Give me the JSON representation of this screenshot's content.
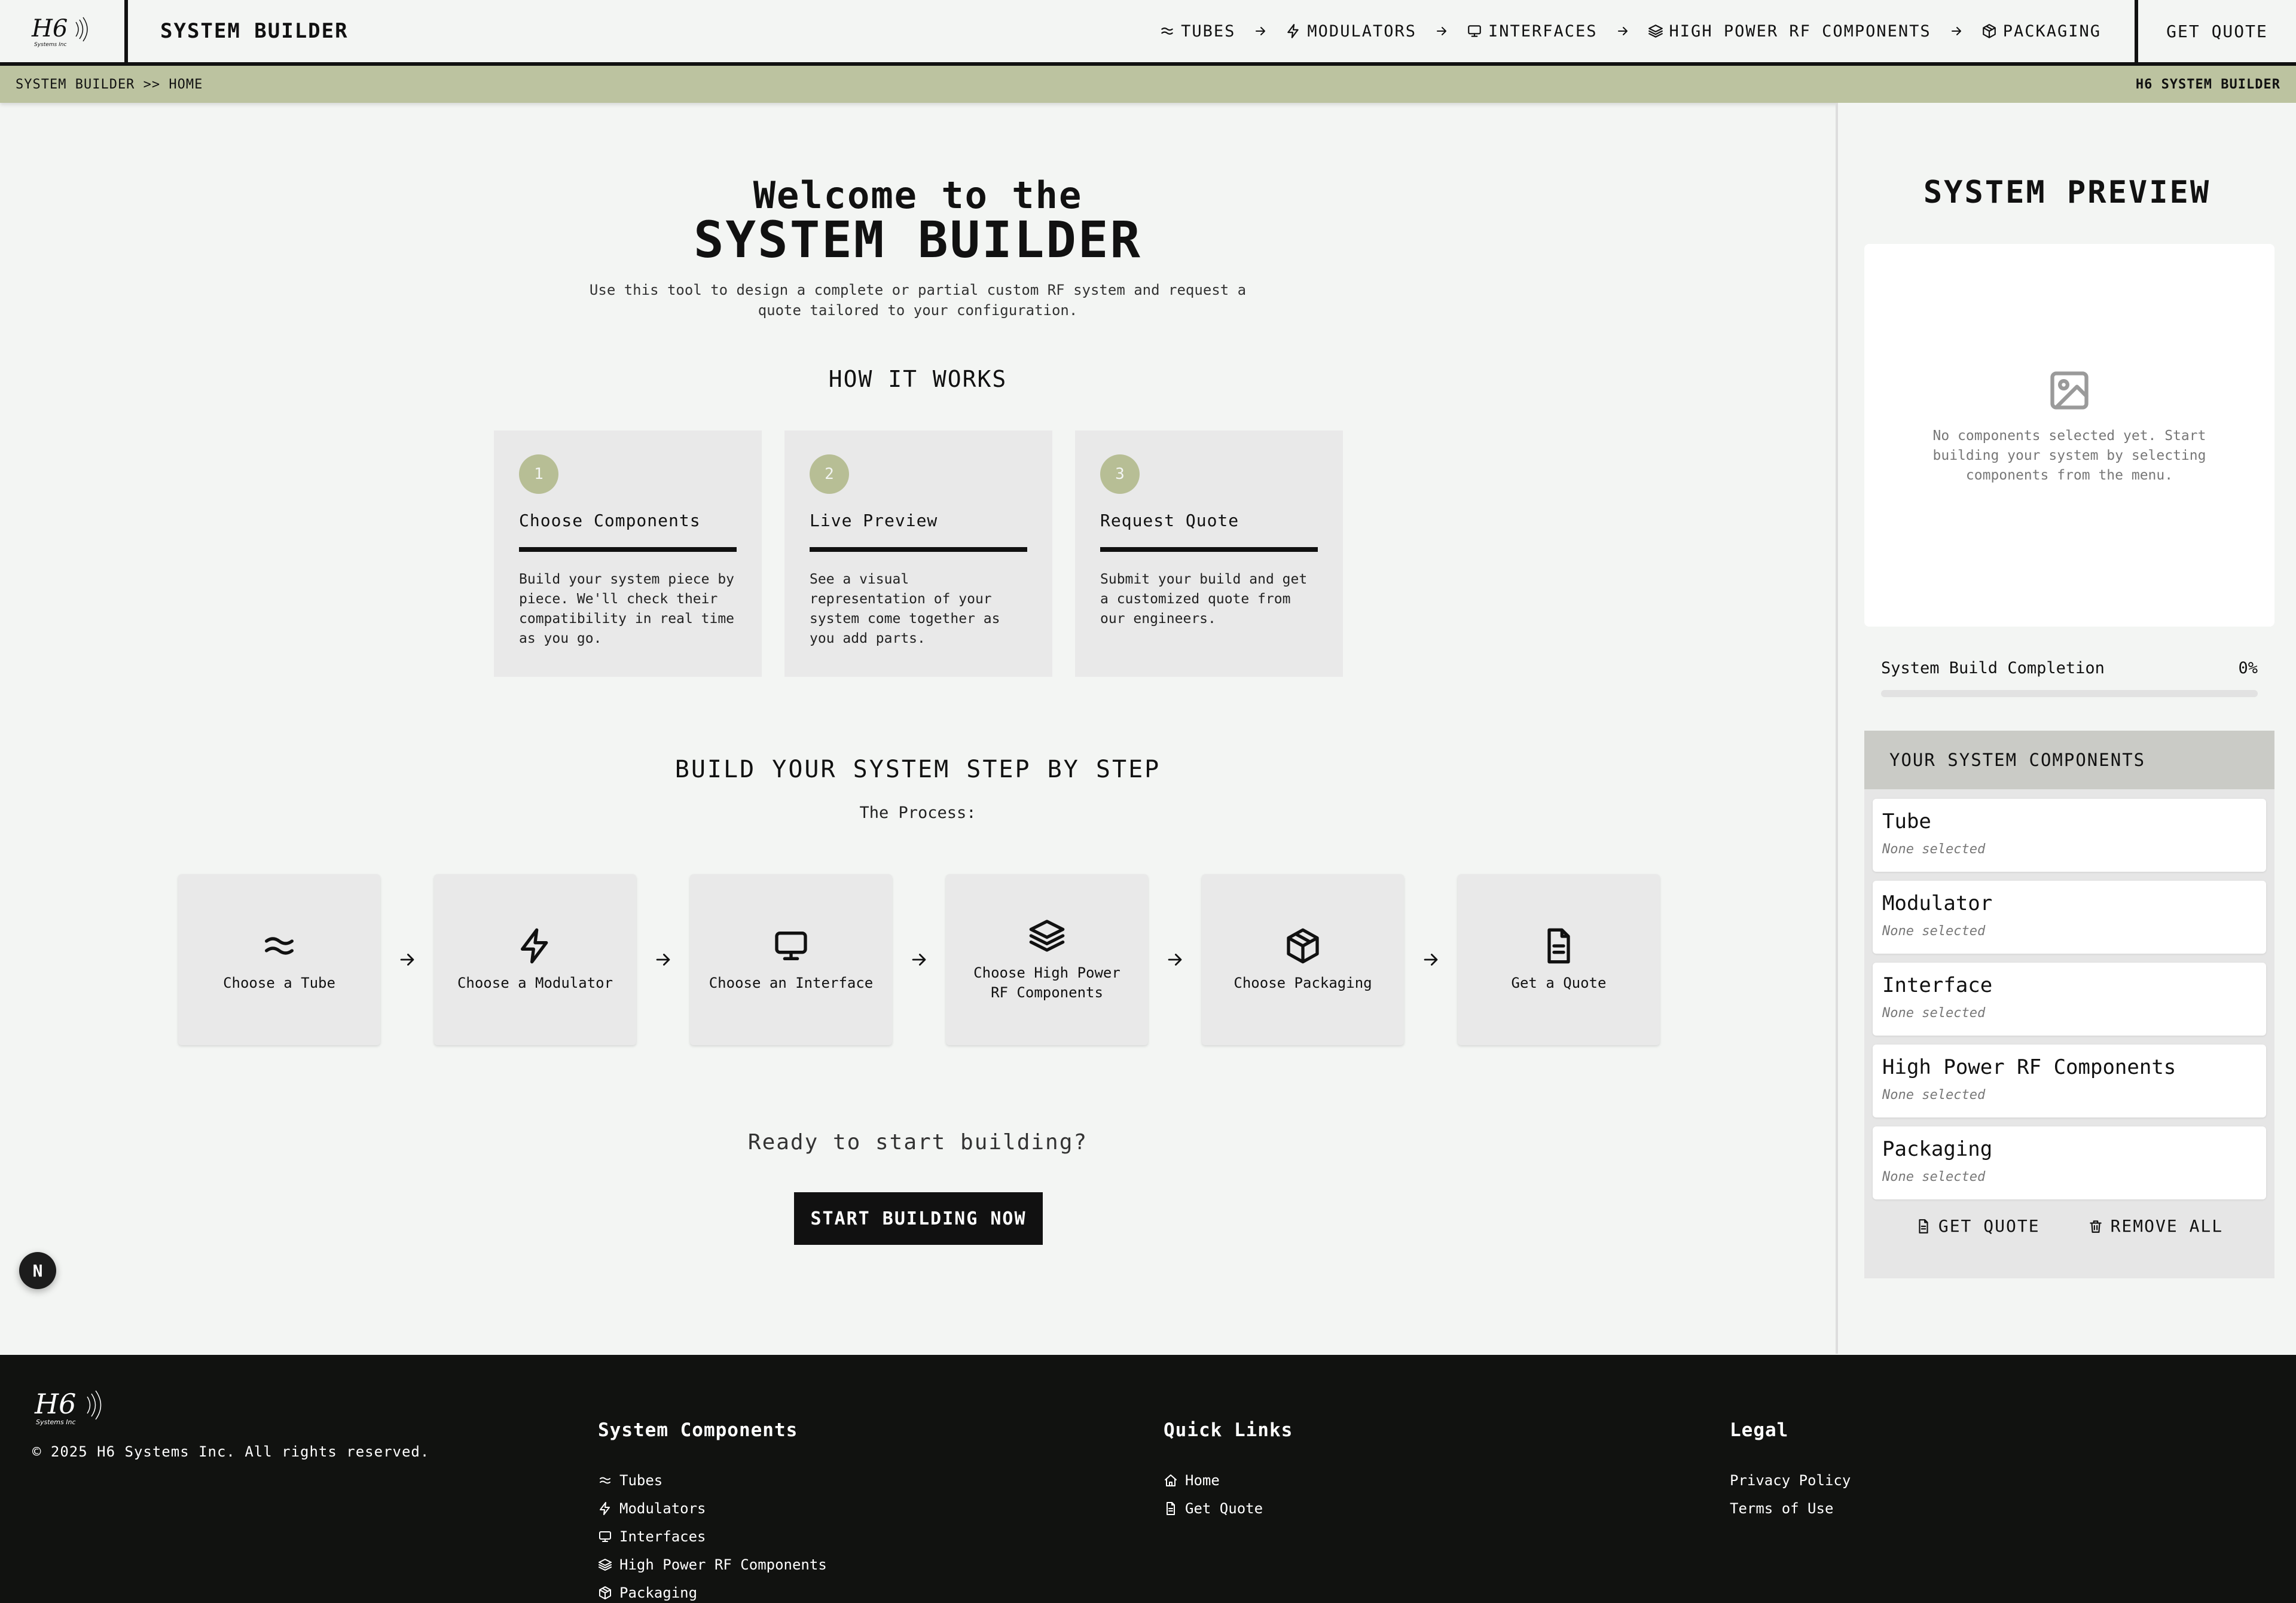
{
  "header": {
    "logo_text": "H6",
    "logo_sub": "Systems Inc",
    "title": "SYSTEM BUILDER",
    "nav": [
      {
        "label": "TUBES",
        "icon": "wave-icon"
      },
      {
        "label": "MODULATORS",
        "icon": "zap-icon"
      },
      {
        "label": "INTERFACES",
        "icon": "monitor-icon"
      },
      {
        "label": "HIGH POWER RF COMPONENTS",
        "icon": "layers-icon"
      },
      {
        "label": "PACKAGING",
        "icon": "box-icon"
      }
    ],
    "quote_label": "GET QUOTE"
  },
  "breadcrumb": {
    "path": "SYSTEM BUILDER >> HOME",
    "right": "H6 SYSTEM BUILDER"
  },
  "welcome": {
    "line1": "Welcome to the",
    "line2": "SYSTEM BUILDER",
    "intro": "Use this tool to design a complete or partial custom RF system and request a quote tailored to your configuration."
  },
  "how": {
    "title": "HOW IT WORKS",
    "cards": [
      {
        "num": "1",
        "title": "Choose Components",
        "text": "Build your system piece by piece. We'll check their compatibility in real time as you go."
      },
      {
        "num": "2",
        "title": "Live Preview",
        "text": "See a visual representation of your system come together as you add parts."
      },
      {
        "num": "3",
        "title": "Request Quote",
        "text": "Submit your build and get a customized quote from our engineers."
      }
    ]
  },
  "steps": {
    "title": "BUILD YOUR SYSTEM STEP BY STEP",
    "subtitle": "The Process:",
    "items": [
      {
        "label": "Choose a Tube",
        "icon": "wave-icon"
      },
      {
        "label": "Choose a Modulator",
        "icon": "zap-icon"
      },
      {
        "label": "Choose an Interface",
        "icon": "monitor-icon"
      },
      {
        "label": "Choose High Power RF Components",
        "icon": "layers-icon"
      },
      {
        "label": "Choose Packaging",
        "icon": "box-icon"
      },
      {
        "label": "Get a Quote",
        "icon": "file-icon"
      }
    ]
  },
  "cta": {
    "question": "Ready to start building?",
    "button": "START BUILDING NOW"
  },
  "badge": "N",
  "sidebar": {
    "title": "SYSTEM PREVIEW",
    "empty_text": "No components selected yet. Start building your system by selecting components from the menu.",
    "completion_label": "System Build Completion",
    "completion_value": "0%",
    "completion_fraction": 0,
    "components_title": "YOUR SYSTEM COMPONENTS",
    "components": [
      {
        "name": "Tube",
        "status": "None selected"
      },
      {
        "name": "Modulator",
        "status": "None selected"
      },
      {
        "name": "Interface",
        "status": "None selected"
      },
      {
        "name": "High Power RF Components",
        "status": "None selected"
      },
      {
        "name": "Packaging",
        "status": "None selected"
      }
    ],
    "get_quote": "GET QUOTE",
    "remove_all": "REMOVE ALL"
  },
  "footer": {
    "copyright": "© 2025 H6 Systems Inc. All rights reserved.",
    "col1_title": "System Components",
    "col1_links": [
      {
        "label": "Tubes",
        "icon": "wave-icon"
      },
      {
        "label": "Modulators",
        "icon": "zap-icon"
      },
      {
        "label": "Interfaces",
        "icon": "monitor-icon"
      },
      {
        "label": "High Power RF Components",
        "icon": "layers-icon"
      },
      {
        "label": "Packaging",
        "icon": "box-icon"
      }
    ],
    "col2_title": "Quick Links",
    "col2_links": [
      {
        "label": "Home",
        "icon": "home-icon"
      },
      {
        "label": "Get Quote",
        "icon": "file-icon"
      }
    ],
    "col3_title": "Legal",
    "col3_links": [
      {
        "label": "Privacy Policy"
      },
      {
        "label": "Terms of Use"
      }
    ]
  },
  "colors": {
    "accent": "#bcc3a0",
    "dark": "#111111",
    "background": "#f3f5f3"
  }
}
